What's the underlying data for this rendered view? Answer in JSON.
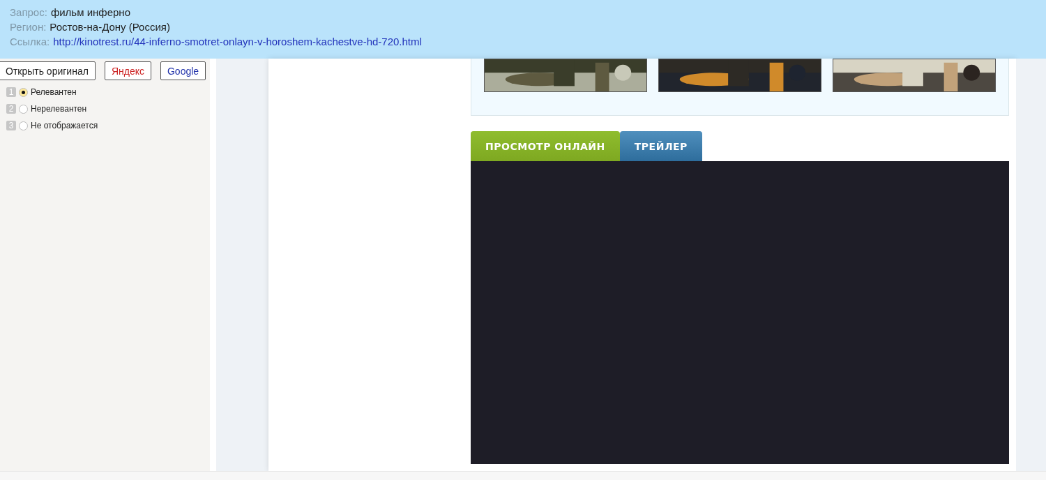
{
  "query": {
    "label": "Запрос:",
    "value": "фильм инферно"
  },
  "region": {
    "label": "Регион:",
    "value": "Ростов-на-Дону (Россия)"
  },
  "link": {
    "label": "Ссылка:",
    "value": "http://kinotrest.ru/44-inferno-smotret-onlayn-v-horoshem-kachestve-hd-720.html"
  },
  "buttons": [
    {
      "label": "Открыть оригинал",
      "kind": "plain"
    },
    {
      "label": "Яндекс",
      "kind": "yandex"
    },
    {
      "label": "Google",
      "kind": "google"
    }
  ],
  "ratings": [
    {
      "number": "1",
      "label": "Релевантен",
      "selected": true
    },
    {
      "number": "2",
      "label": "Нерелевантен",
      "selected": false
    },
    {
      "number": "3",
      "label": "Не отображается",
      "selected": false
    }
  ],
  "tabs": [
    {
      "label": "ПРОСМОТР ОНЛАЙН",
      "selected": true
    },
    {
      "label": "ТРЕЙЛЕР",
      "selected": false
    }
  ]
}
